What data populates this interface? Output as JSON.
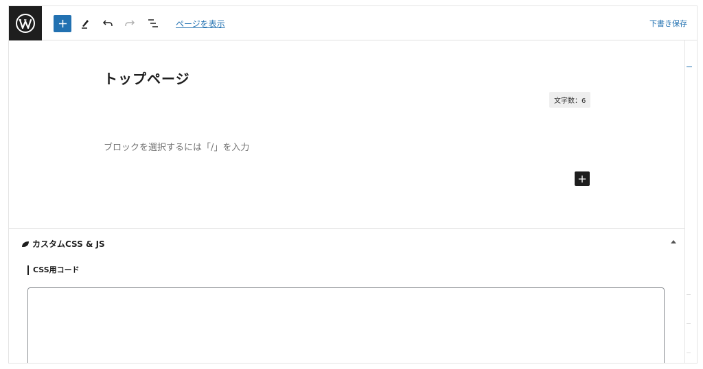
{
  "toolbar": {
    "logo_icon": "wordpress-logo-icon",
    "add_block_icon": "plus-icon",
    "tools_icon": "pencil-icon",
    "undo_icon": "undo-icon",
    "redo_icon": "redo-icon",
    "list_view_icon": "list-view-icon",
    "view_page_label": "ページを表示",
    "save_draft_label": "下書き保存"
  },
  "editor": {
    "title": "トップページ",
    "word_count": "文字数：6",
    "block_placeholder": "ブロックを選択するには「/」を入力"
  },
  "metabox": {
    "title": "カスタムCSS & JS",
    "css_section_label": "CSS用コード",
    "css_code_value": ""
  },
  "colors": {
    "accent": "#2271b1",
    "dark": "#1e1e1e",
    "placeholder_text": "#757575"
  }
}
